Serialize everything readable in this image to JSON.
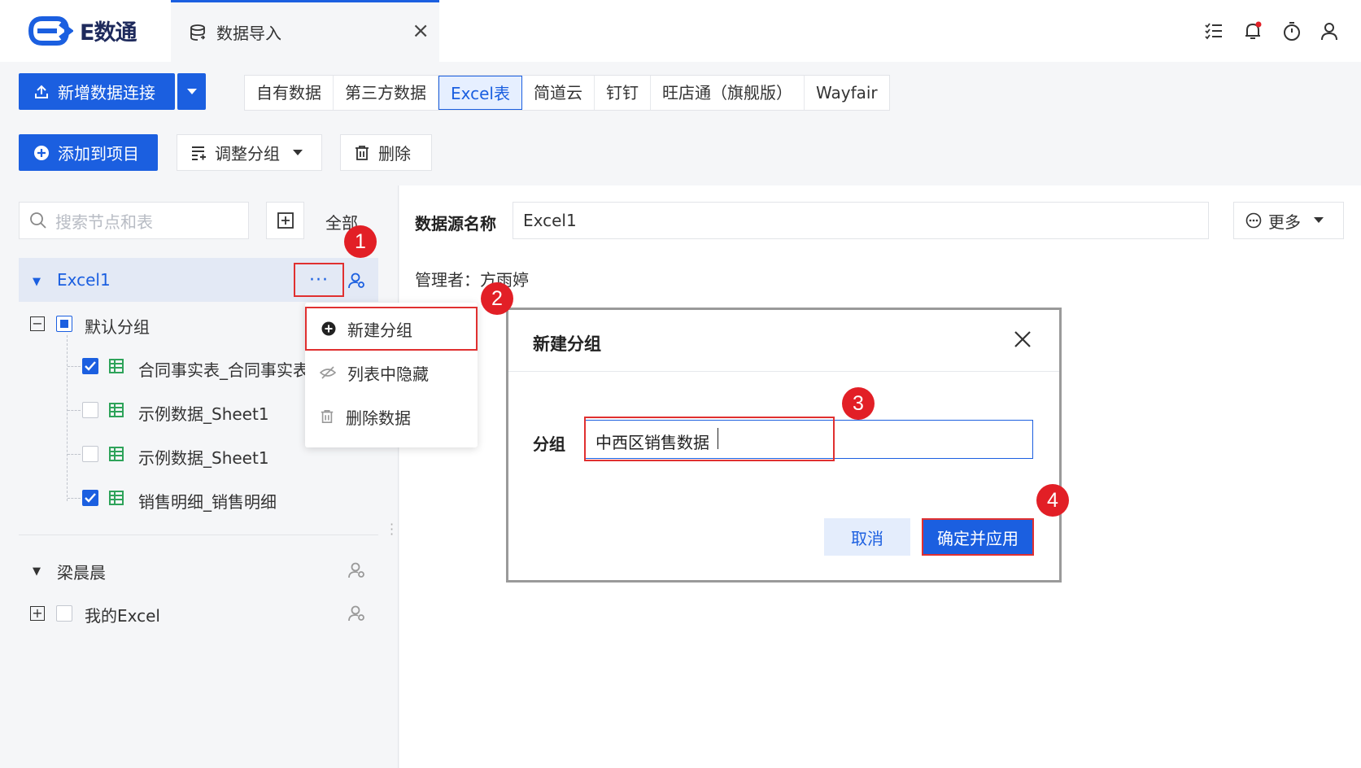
{
  "app": {
    "logo_text": "E数通"
  },
  "tab": {
    "label": "数据导入",
    "close": "×"
  },
  "toolbar": {
    "new_connection": "新增数据连接",
    "add_to_project": "添加到项目",
    "adjust_group": "调整分组",
    "delete": "删除"
  },
  "source_tabs": [
    {
      "label": "自有数据"
    },
    {
      "label": "第三方数据"
    },
    {
      "label": "Excel表"
    },
    {
      "label": "简道云"
    },
    {
      "label": "钉钉"
    },
    {
      "label": "旺店通（旗舰版）"
    },
    {
      "label": "Wayfair"
    }
  ],
  "sidebar": {
    "search_placeholder": "搜索节点和表",
    "all_label": "全部",
    "root": {
      "label": "Excel1",
      "more": "···"
    },
    "group": {
      "label": "默认分组"
    },
    "tables": [
      {
        "label": "合同事实表_合同事实表",
        "checked": true
      },
      {
        "label": "示例数据_Sheet1",
        "checked": false
      },
      {
        "label": "示例数据_Sheet1",
        "checked": false
      },
      {
        "label": "销售明细_销售明细",
        "checked": true
      }
    ],
    "root2": {
      "label": "梁晨晨"
    },
    "group2": {
      "label": "我的Excel"
    }
  },
  "context_menu": {
    "new_group": "新建分组",
    "hide_in_list": "列表中隐藏",
    "delete_data": "删除数据"
  },
  "detail": {
    "ds_name_label": "数据源名称",
    "ds_name_value": "Excel1",
    "admin": "管理者：方雨婷",
    "more": "更多"
  },
  "dialog": {
    "title": "新建分组",
    "field_label": "分组",
    "field_value": "中西区销售数据",
    "cancel": "取消",
    "confirm": "确定并应用"
  },
  "markers": [
    "1",
    "2",
    "3",
    "4"
  ],
  "colors": {
    "primary": "#1b5fe0",
    "highlight": "#e03030",
    "marker": "#e21f26"
  }
}
